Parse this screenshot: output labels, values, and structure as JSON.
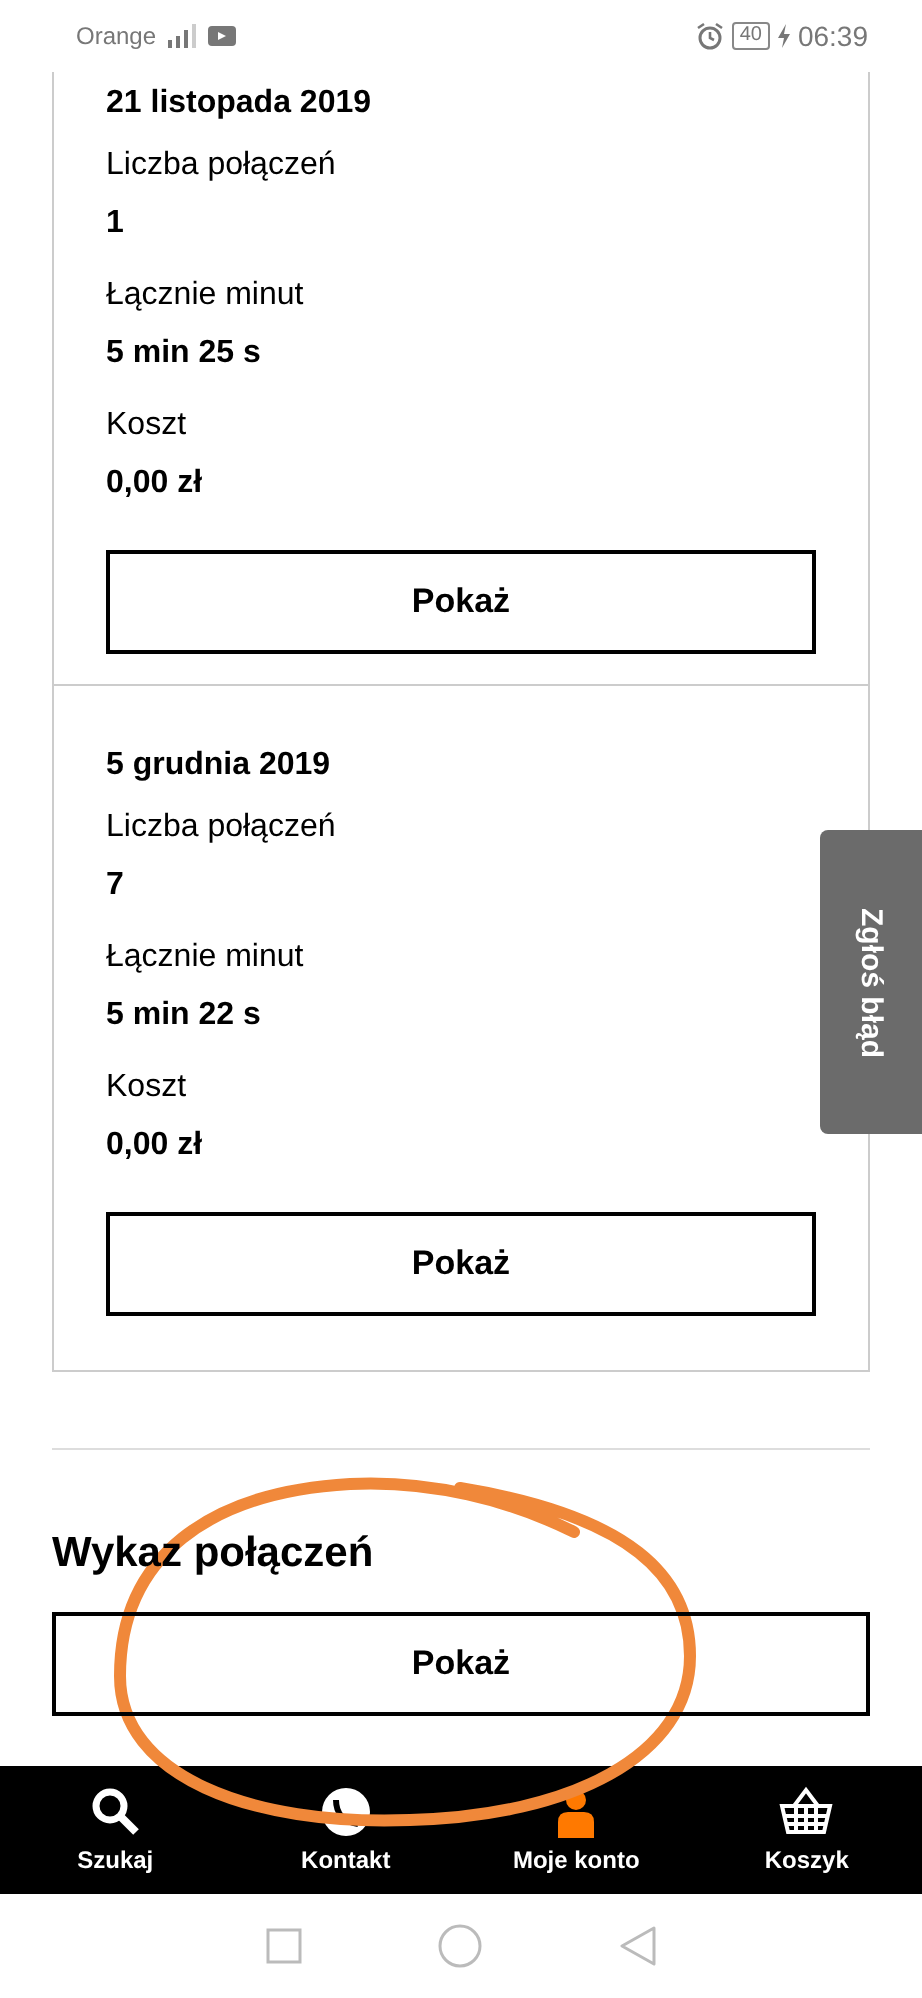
{
  "status_bar": {
    "carrier": "Orange",
    "battery": "40",
    "time": "06:39"
  },
  "days": [
    {
      "date": "21 listopada 2019",
      "fields": [
        {
          "label": "Liczba połączeń",
          "value": "1"
        },
        {
          "label": "Łącznie minut",
          "value": "5 min 25 s"
        },
        {
          "label": "Koszt",
          "value": "0,00 zł"
        }
      ],
      "button": "Pokaż"
    },
    {
      "date": "5 grudnia 2019",
      "fields": [
        {
          "label": "Liczba połączeń",
          "value": "7"
        },
        {
          "label": "Łącznie minut",
          "value": "5 min 22 s"
        },
        {
          "label": "Koszt",
          "value": "0,00 zł"
        }
      ],
      "button": "Pokaż"
    }
  ],
  "feedback_tab": "Zgłoś błąd",
  "call_list": {
    "title": "Wykaz połączeń",
    "button": "Pokaż"
  },
  "bottom_nav": [
    {
      "kind": "search",
      "label": "Szukaj",
      "selected": false
    },
    {
      "kind": "contact",
      "label": "Kontakt",
      "selected": false
    },
    {
      "kind": "account",
      "label": "Moje konto",
      "selected": true
    },
    {
      "kind": "basket",
      "label": "Koszyk",
      "selected": false
    }
  ],
  "annotation": {
    "kind": "ellipse",
    "color": "#f0883a"
  }
}
